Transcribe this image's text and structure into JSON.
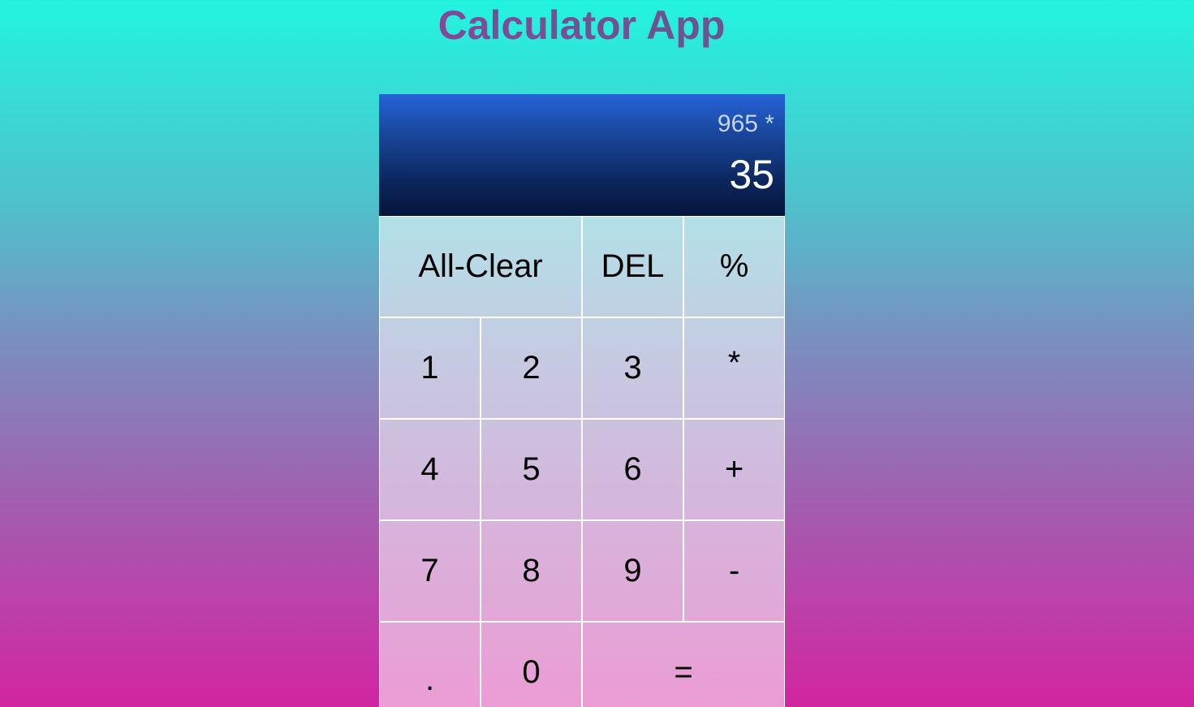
{
  "header": {
    "title": "Calculator App"
  },
  "display": {
    "previous_operand": "965 *",
    "current_operand": "35"
  },
  "keys": {
    "all_clear": "All-Clear",
    "delete": "DEL",
    "percent": "%",
    "one": "1",
    "two": "2",
    "three": "3",
    "multiply": "*",
    "four": "4",
    "five": "5",
    "six": "6",
    "plus": "+",
    "seven": "7",
    "eight": "8",
    "nine": "9",
    "minus": "-",
    "decimal": ".",
    "zero": "0",
    "equals": "="
  },
  "colors": {
    "background_top": "#22f4df",
    "background_bottom": "#d324a0",
    "display_top": "#2563d9",
    "display_bottom": "#04153a",
    "title_gradient_start": "#b22fa0",
    "title_gradient_end": "#3a6a87"
  }
}
